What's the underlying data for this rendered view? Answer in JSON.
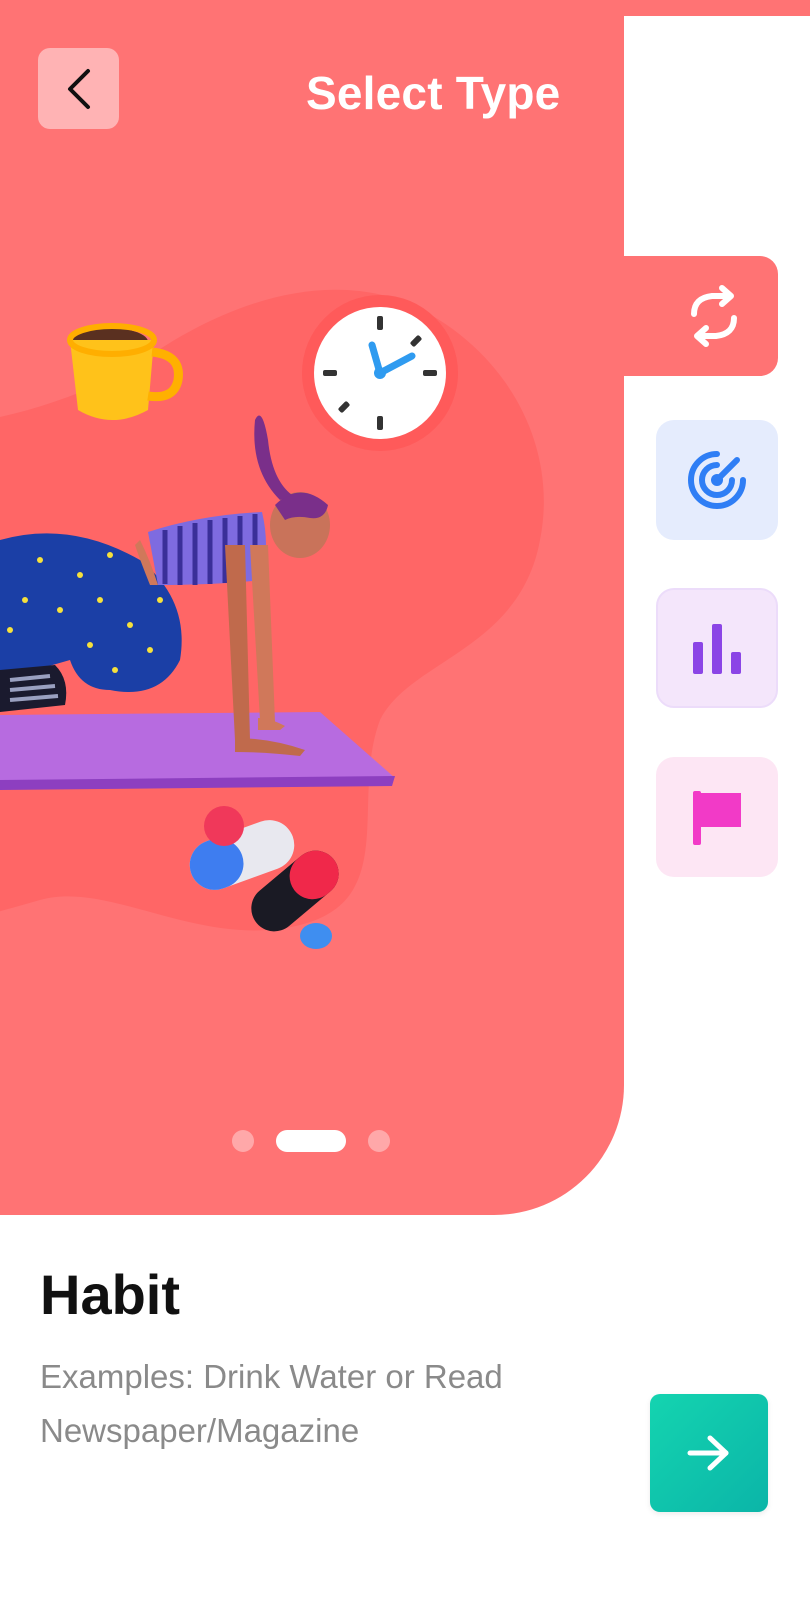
{
  "header": {
    "title": "Select Type",
    "back_icon": "chevron-left-icon"
  },
  "carousel": {
    "slide_count": 3,
    "active_index": 1
  },
  "type_selector": {
    "active_icon": "repeat-icon",
    "options": [
      {
        "icon": "target-icon",
        "color": "#2f7ef5",
        "bg": "#e5ecfd"
      },
      {
        "icon": "bar-chart-icon",
        "color": "#8b45e6",
        "bg": "#f4e6fb"
      },
      {
        "icon": "flag-icon",
        "color": "#f23ac7",
        "bg": "#fde6f4"
      }
    ]
  },
  "selected_type": {
    "name": "Habit",
    "description": "Examples: Drink Water or Read Newspaper/Magazine"
  },
  "next_button": {
    "icon": "arrow-right-icon"
  },
  "colors": {
    "accent": "#ff7374",
    "next_button": "#0fc4ac"
  }
}
